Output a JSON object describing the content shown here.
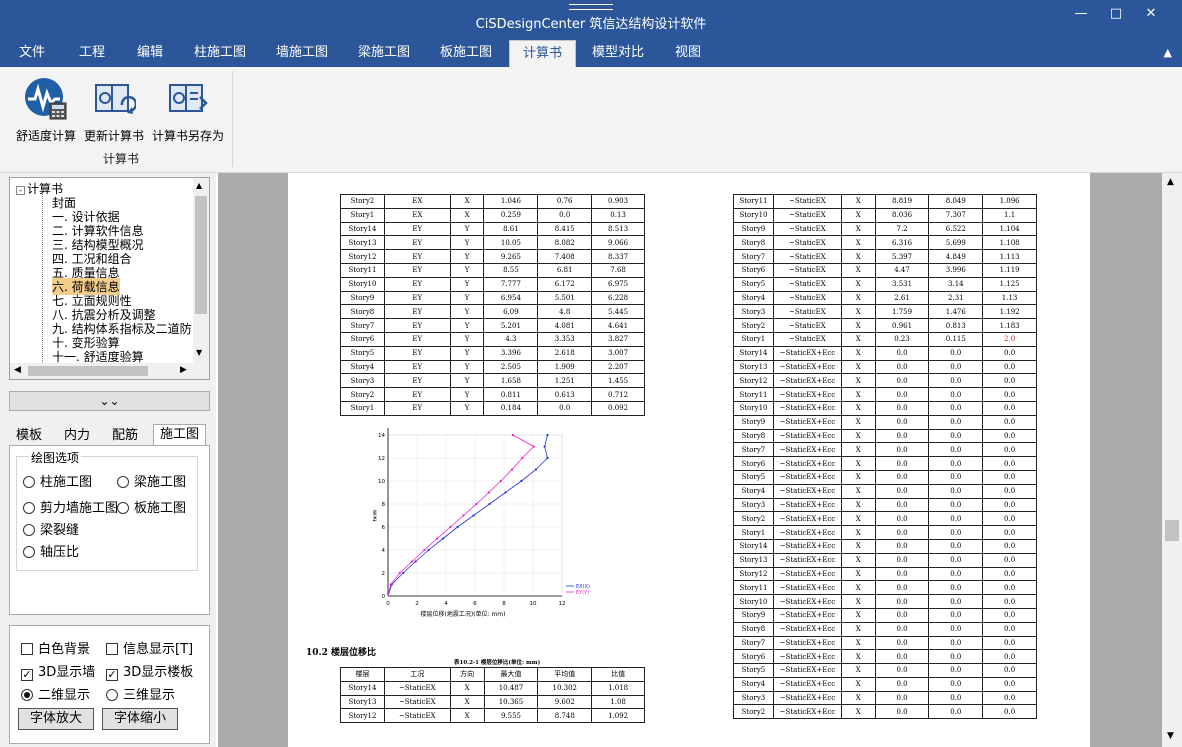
{
  "app": {
    "title": "CiSDesignCenter 筑信达结构设计软件"
  },
  "menu": {
    "tabs": [
      "文件",
      "工程",
      "编辑",
      "柱施工图",
      "墙施工图",
      "梁施工图",
      "板施工图",
      "计算书",
      "模型对比",
      "视图"
    ],
    "active_tab": "计算书"
  },
  "ribbon": {
    "buttons": [
      "舒适度计算",
      "更新计算书",
      "计算书另存为"
    ],
    "group_label": "计算书"
  },
  "tree": {
    "root": "计算书",
    "items": [
      "封面",
      "一. 设计依据",
      "二. 计算软件信息",
      "三. 结构模型概况",
      "四. 工况和组合",
      "五. 质量信息",
      "六. 荷载信息",
      "七. 立面规则性",
      "八. 抗震分析及调整",
      "九. 结构体系指标及二道防",
      "十. 变形验算",
      "十一. 舒适度验算"
    ],
    "selected": "六. 荷载信息"
  },
  "panel_tabs": [
    "模板",
    "内力",
    "配筋",
    "施工图"
  ],
  "active_panel_tab": "施工图",
  "drawing_options": {
    "legend": "绘图选项",
    "options": [
      "柱施工图",
      "梁施工图",
      "剪力墙施工图",
      "板施工图",
      "梁裂缝",
      "轴压比"
    ]
  },
  "display": {
    "white_bg": "白色背景",
    "info_display": "信息显示[T]",
    "wall_3d": "3D显示墙",
    "slab_3d": "3D显示楼板",
    "view_2d": "二维显示",
    "view_3d": "三维显示",
    "font_up": "字体放大",
    "font_down": "字体缩小"
  },
  "doc": {
    "left_table": [
      [
        "Story2",
        "EX",
        "X",
        "1.046",
        "0.76",
        "0.903"
      ],
      [
        "Story1",
        "EX",
        "X",
        "0.259",
        "0.0",
        "0.13"
      ],
      [
        "Story14",
        "EY",
        "Y",
        "8.61",
        "8.415",
        "8.513"
      ],
      [
        "Story13",
        "EY",
        "Y",
        "10.05",
        "8.082",
        "9.066"
      ],
      [
        "Story12",
        "EY",
        "Y",
        "9.265",
        "7.408",
        "8.337"
      ],
      [
        "Story11",
        "EY",
        "Y",
        "8.55",
        "6.81",
        "7.68"
      ],
      [
        "Story10",
        "EY",
        "Y",
        "7.777",
        "6.172",
        "6.975"
      ],
      [
        "Story9",
        "EY",
        "Y",
        "6.954",
        "5.501",
        "6.228"
      ],
      [
        "Story8",
        "EY",
        "Y",
        "6.09",
        "4.8",
        "5.445"
      ],
      [
        "Story7",
        "EY",
        "Y",
        "5.201",
        "4.081",
        "4.641"
      ],
      [
        "Story6",
        "EY",
        "Y",
        "4.3",
        "3.353",
        "3.827"
      ],
      [
        "Story5",
        "EY",
        "Y",
        "3.396",
        "2.618",
        "3.007"
      ],
      [
        "Story4",
        "EY",
        "Y",
        "2.505",
        "1.909",
        "2.207"
      ],
      [
        "Story3",
        "EY",
        "Y",
        "1.658",
        "1.251",
        "1.455"
      ],
      [
        "Story2",
        "EY",
        "Y",
        "0.811",
        "0.613",
        "0.712"
      ],
      [
        "Story1",
        "EY",
        "Y",
        "0.184",
        "0.0",
        "0.092"
      ]
    ],
    "section_title": "10.2 楼层位移比",
    "table_caption": "表10.2-1 楼层位移比(单位: mm)",
    "bottom_headers": [
      "楼层",
      "工况",
      "方向",
      "最大值",
      "平均值",
      "比值"
    ],
    "bottom_rows": [
      [
        "Story14",
        "~StaticEX",
        "X",
        "10.487",
        "10.302",
        "1.018"
      ],
      [
        "Story13",
        "~StaticEX",
        "X",
        "10.365",
        "9.602",
        "1.08"
      ],
      [
        "Story12",
        "~StaticEX",
        "X",
        "9.555",
        "8.748",
        "1.092"
      ]
    ],
    "right_table": [
      [
        "Story11",
        "~StaticEX",
        "X",
        "8.819",
        "8.049",
        "1.096"
      ],
      [
        "Story10",
        "~StaticEX",
        "X",
        "8.036",
        "7.307",
        "1.1"
      ],
      [
        "Story9",
        "~StaticEX",
        "X",
        "7.2",
        "6.522",
        "1.104"
      ],
      [
        "Story8",
        "~StaticEX",
        "X",
        "6.316",
        "5.699",
        "1.108"
      ],
      [
        "Story7",
        "~StaticEX",
        "X",
        "5.397",
        "4.849",
        "1.113"
      ],
      [
        "Story6",
        "~StaticEX",
        "X",
        "4.47",
        "3.996",
        "1.119"
      ],
      [
        "Story5",
        "~StaticEX",
        "X",
        "3.531",
        "3.14",
        "1.125"
      ],
      [
        "Story4",
        "~StaticEX",
        "X",
        "2.61",
        "2.31",
        "1.13"
      ],
      [
        "Story3",
        "~StaticEX",
        "X",
        "1.759",
        "1.476",
        "1.192"
      ],
      [
        "Story2",
        "~StaticEX",
        "X",
        "0.961",
        "0.813",
        "1.183"
      ],
      [
        "Story1",
        "~StaticEX",
        "X",
        "0.23",
        "0.115",
        "2.0"
      ],
      [
        "Story14",
        "~StaticEX+Ecc",
        "X",
        "0.0",
        "0.0",
        "0.0"
      ],
      [
        "Story13",
        "~StaticEX+Ecc",
        "X",
        "0.0",
        "0.0",
        "0.0"
      ],
      [
        "Story12",
        "~StaticEX+Ecc",
        "X",
        "0.0",
        "0.0",
        "0.0"
      ],
      [
        "Story11",
        "~StaticEX+Ecc",
        "X",
        "0.0",
        "0.0",
        "0.0"
      ],
      [
        "Story10",
        "~StaticEX+Ecc",
        "X",
        "0.0",
        "0.0",
        "0.0"
      ],
      [
        "Story9",
        "~StaticEX+Ecc",
        "X",
        "0.0",
        "0.0",
        "0.0"
      ],
      [
        "Story8",
        "~StaticEX+Ecc",
        "X",
        "0.0",
        "0.0",
        "0.0"
      ],
      [
        "Story7",
        "~StaticEX+Ecc",
        "X",
        "0.0",
        "0.0",
        "0.0"
      ],
      [
        "Story6",
        "~StaticEX+Ecc",
        "X",
        "0.0",
        "0.0",
        "0.0"
      ],
      [
        "Story5",
        "~StaticEX+Ecc",
        "X",
        "0.0",
        "0.0",
        "0.0"
      ],
      [
        "Story4",
        "~StaticEX+Ecc",
        "X",
        "0.0",
        "0.0",
        "0.0"
      ],
      [
        "Story3",
        "~StaticEX+Ecc",
        "X",
        "0.0",
        "0.0",
        "0.0"
      ],
      [
        "Story2",
        "~StaticEX+Ecc",
        "X",
        "0.0",
        "0.0",
        "0.0"
      ],
      [
        "Story1",
        "~StaticEX+Ecc",
        "X",
        "0.0",
        "0.0",
        "0.0"
      ],
      [
        "Story14",
        "~StaticEX+Ecc",
        "X",
        "0.0",
        "0.0",
        "0.0"
      ],
      [
        "Story13",
        "~StaticEX+Ecc",
        "X",
        "0.0",
        "0.0",
        "0.0"
      ],
      [
        "Story12",
        "~StaticEX+Ecc",
        "X",
        "0.0",
        "0.0",
        "0.0"
      ],
      [
        "Story11",
        "~StaticEX+Ecc",
        "X",
        "0.0",
        "0.0",
        "0.0"
      ],
      [
        "Story10",
        "~StaticEX+Ecc",
        "X",
        "0.0",
        "0.0",
        "0.0"
      ],
      [
        "Story9",
        "~StaticEX+Ecc",
        "X",
        "0.0",
        "0.0",
        "0.0"
      ],
      [
        "Story8",
        "~StaticEX+Ecc",
        "X",
        "0.0",
        "0.0",
        "0.0"
      ],
      [
        "Story7",
        "~StaticEX+Ecc",
        "X",
        "0.0",
        "0.0",
        "0.0"
      ],
      [
        "Story6",
        "~StaticEX+Ecc",
        "X",
        "0.0",
        "0.0",
        "0.0"
      ],
      [
        "Story5",
        "~StaticEX+Ecc",
        "X",
        "0.0",
        "0.0",
        "0.0"
      ],
      [
        "Story4",
        "~StaticEX+Ecc",
        "X",
        "0.0",
        "0.0",
        "0.0"
      ],
      [
        "Story3",
        "~StaticEX+Ecc",
        "X",
        "0.0",
        "0.0",
        "0.0"
      ],
      [
        "Story2",
        "~StaticEX+Ecc",
        "X",
        "0.0",
        "0.0",
        "0.0"
      ]
    ]
  },
  "chart_data": {
    "type": "line",
    "title": "",
    "xlabel": "楼层位移(地震工况)(单位: mm)",
    "ylabel": "楼层",
    "xlim": [
      0,
      12
    ],
    "ylim": [
      0,
      14
    ],
    "xticks": [
      0,
      2,
      4,
      6,
      8,
      10,
      12
    ],
    "yticks": [
      0,
      2,
      4,
      6,
      8,
      10,
      12,
      14
    ],
    "legend_position": "bottom-right",
    "series": [
      {
        "name": "EX(X)",
        "color": "#2233dd",
        "x": [
          0.259,
          1.046,
          1.9,
          2.8,
          3.8,
          4.8,
          5.9,
          7.0,
          8.1,
          9.2,
          10.2,
          11.0,
          10.8,
          11.0
        ],
        "y": [
          1,
          2,
          3,
          4,
          5,
          6,
          7,
          8,
          9,
          10,
          11,
          12,
          13,
          14
        ]
      },
      {
        "name": "EY(Y)",
        "color": "#ee22cc",
        "x": [
          0.184,
          0.811,
          1.658,
          2.505,
          3.396,
          4.3,
          5.201,
          6.09,
          6.954,
          7.777,
          8.55,
          9.265,
          10.05,
          8.61
        ],
        "y": [
          1,
          2,
          3,
          4,
          5,
          6,
          7,
          8,
          9,
          10,
          11,
          12,
          13,
          14
        ]
      }
    ]
  }
}
